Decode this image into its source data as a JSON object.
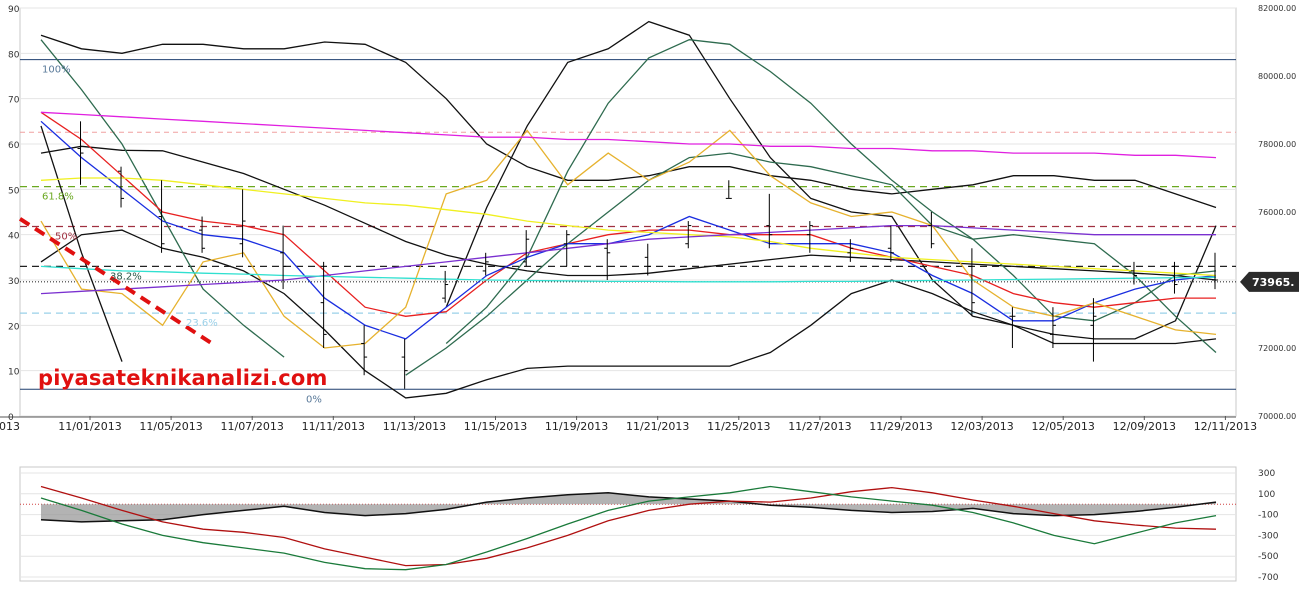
{
  "colors": {
    "black": "#111111",
    "darkgreen": "#2e6b4f",
    "red": "#e82020",
    "blue": "#1a2ee0",
    "gold": "#e6b22e",
    "yellow": "#f0f020",
    "magenta": "#e020e0",
    "purple": "#7a30d0",
    "cyan": "#30e0d0",
    "navy": "#1f3f6f",
    "osc_red": "#b01010",
    "osc_green": "#1a7a3a",
    "osc_hist": "#999999",
    "fib_green": "#6aa820",
    "fib_maroon": "#a03040",
    "fib_lightblue": "#9ad0e8",
    "fib_gray": "#5a7a9a",
    "pink_dash": "#f0a0a0",
    "trend": "#e01010",
    "watermark": "#e01010"
  },
  "watermark": "piyasateknikanalizi.com",
  "last_price": "73965.",
  "chart_data": [
    {
      "type": "line",
      "x": [
        "10/30/2013",
        "11/01/2013",
        "11/04/2013",
        "11/05/2013",
        "11/06/2013",
        "11/07/2013",
        "11/08/2013",
        "11/11/2013",
        "11/12/2013",
        "11/13/2013",
        "11/14/2013",
        "11/15/2013",
        "11/18/2013",
        "11/19/2013",
        "11/20/2013",
        "11/21/2013",
        "11/22/2013",
        "11/25/2013",
        "11/26/2013",
        "11/27/2013",
        "11/28/2013",
        "11/29/2013",
        "12/02/2013",
        "12/03/2013",
        "12/04/2013",
        "12/05/2013",
        "12/06/2013",
        "12/09/2013",
        "12/10/2013",
        "12/11/2013"
      ],
      "x_tick_labels": [
        "2013",
        "11/01/2013",
        "11/05/2013",
        "11/07/2013",
        "11/11/2013",
        "11/13/2013",
        "11/15/2013",
        "11/19/2013",
        "11/21/2013",
        "11/25/2013",
        "11/27/2013",
        "11/29/2013",
        "12/03/2013",
        "12/05/2013",
        "12/09/2013",
        "12/11/2013"
      ],
      "y_left_ticks": [
        "0",
        "10",
        "20",
        "30",
        "40",
        "50",
        "60",
        "70",
        "80",
        "90"
      ],
      "y_left_range": [
        0,
        90
      ],
      "y_right_ticks": [
        "70000.00",
        "72000.00",
        "74000.00",
        "76000.00",
        "78000.00",
        "80000.00",
        "82000.00"
      ],
      "y_right_range": [
        70000,
        82000
      ],
      "grid": true,
      "fib_levels": [
        {
          "label": "100%",
          "value": 78.6
        },
        {
          "label": "61.8%",
          "value": 50.6
        },
        {
          "label": "50%",
          "value": 41.8
        },
        {
          "label": "38.2%",
          "value": 33.0
        },
        {
          "label": "23.6%",
          "value": 22.7
        },
        {
          "label": "0%",
          "value": 5.9
        }
      ],
      "candles": [
        {
          "o": 74.4,
          "h": 64,
          "l": 54,
          "c": 60
        },
        {
          "o": 59,
          "h": 65,
          "l": 51,
          "c": 58
        },
        {
          "o": 54,
          "h": 55,
          "l": 46,
          "c": 48
        },
        {
          "o": 44,
          "h": 52,
          "l": 36,
          "c": 38
        },
        {
          "o": 41,
          "h": 44,
          "l": 36,
          "c": 37
        },
        {
          "o": 38,
          "h": 50,
          "l": 35,
          "c": 43
        },
        {
          "o": 36,
          "h": 42,
          "l": 28,
          "c": 33
        },
        {
          "o": 25,
          "h": 34,
          "l": 15,
          "c": 18
        },
        {
          "o": 16,
          "h": 20,
          "l": 9,
          "c": 13
        },
        {
          "o": 13,
          "h": 17,
          "l": 6,
          "c": 10
        },
        {
          "o": 26,
          "h": 32,
          "l": 25,
          "c": 29
        },
        {
          "o": 32,
          "h": 36,
          "l": 31,
          "c": 34
        },
        {
          "o": 34,
          "h": 41,
          "l": 33,
          "c": 39
        },
        {
          "o": 38,
          "h": 41,
          "l": 33,
          "c": 40
        },
        {
          "o": 37,
          "h": 39,
          "l": 30,
          "c": 36
        },
        {
          "o": 35,
          "h": 38,
          "l": 31,
          "c": 33
        },
        {
          "o": 38,
          "h": 43,
          "l": 37,
          "c": 42
        },
        {
          "o": 48,
          "h": 52,
          "l": 48,
          "c": 48
        },
        {
          "o": 42,
          "h": 49,
          "l": 37,
          "c": 40
        },
        {
          "o": 40,
          "h": 43,
          "l": 36,
          "c": 42
        },
        {
          "o": 36,
          "h": 39,
          "l": 34,
          "c": 37
        },
        {
          "o": 37,
          "h": 42,
          "l": 34,
          "c": 36
        },
        {
          "o": 42,
          "h": 45,
          "l": 37,
          "c": 38
        },
        {
          "o": 33,
          "h": 37,
          "l": 22,
          "c": 25
        },
        {
          "o": 22,
          "h": 24,
          "l": 15,
          "c": 22
        },
        {
          "o": 18,
          "h": 24,
          "l": 15,
          "c": 20
        },
        {
          "o": 20,
          "h": 26,
          "l": 12,
          "c": 22
        },
        {
          "o": 32,
          "h": 34,
          "l": 29,
          "c": 31
        },
        {
          "o": 33,
          "h": 34,
          "l": 27,
          "c": 29
        },
        {
          "o": 30,
          "h": 36,
          "l": 28,
          "c": 30
        }
      ],
      "series": [
        {
          "color": "black",
          "values": [
            58,
            59.5,
            58.6,
            58.5,
            56,
            53.5,
            50,
            46.5,
            42.5,
            38.5,
            35.5,
            33.5,
            32,
            31,
            31,
            31.5,
            32.5,
            33.5,
            34.5,
            35.5,
            35,
            34.5,
            34,
            33.5,
            33,
            32.5,
            32,
            31.5,
            31,
            30
          ]
        },
        {
          "color": "black",
          "values": [
            84,
            81,
            80,
            82,
            82,
            81,
            81,
            82.5,
            82,
            78,
            70,
            60,
            55,
            52,
            52,
            53,
            55,
            55,
            53,
            52,
            50,
            49,
            50,
            51,
            53,
            53,
            52,
            52,
            49,
            46
          ]
        },
        {
          "color": "black",
          "values": [
            34,
            40,
            41,
            37,
            35,
            32,
            27,
            19,
            10,
            4,
            5,
            8,
            10.5,
            11,
            11,
            11,
            11,
            11,
            14,
            20,
            27,
            30,
            27,
            23,
            20,
            16,
            16,
            16,
            16,
            17
          ]
        },
        {
          "color": "black",
          "values": [
            64,
            36,
            12,
            null,
            null,
            null,
            null,
            null,
            null,
            null,
            24,
            46,
            64,
            78,
            81,
            87,
            84,
            70,
            57,
            48,
            45,
            44,
            30,
            22,
            20,
            18,
            17,
            17,
            21,
            42
          ]
        },
        {
          "color": "darkgreen",
          "values": [
            83,
            72,
            60,
            44,
            28,
            20,
            13,
            null,
            null,
            9,
            15,
            22,
            30,
            38,
            45,
            52,
            57,
            58,
            56,
            55,
            53,
            51,
            42,
            39,
            40,
            39,
            38,
            31,
            22,
            14
          ]
        },
        {
          "color": "darkgreen",
          "values": [
            null,
            null,
            null,
            null,
            null,
            null,
            null,
            null,
            null,
            null,
            16,
            24,
            35,
            54,
            69,
            79,
            83,
            82,
            76,
            69,
            60,
            52,
            45,
            39,
            31,
            22,
            21,
            25,
            31,
            32
          ]
        },
        {
          "color": "red",
          "values": [
            67,
            61,
            53,
            45,
            43,
            42,
            40,
            32,
            24,
            22,
            23,
            30,
            36,
            38,
            40,
            41,
            41,
            40,
            40,
            40,
            37,
            35,
            33,
            31,
            27,
            25,
            24,
            25,
            26,
            26
          ]
        },
        {
          "color": "blue",
          "values": [
            65,
            57,
            50,
            43,
            40,
            39,
            36,
            26,
            20,
            17,
            24,
            31,
            35,
            38,
            38,
            40,
            44,
            41,
            38,
            38,
            38,
            36,
            31,
            27,
            21,
            21,
            25,
            28,
            30,
            31
          ]
        },
        {
          "color": "gold",
          "values": [
            43,
            28,
            27,
            20,
            34,
            36,
            22,
            15,
            16,
            24,
            49,
            52,
            63,
            51,
            58,
            52,
            56,
            63,
            53,
            47,
            44,
            45,
            42,
            30,
            24,
            22,
            25,
            22,
            19,
            18
          ]
        },
        {
          "color": "yellow",
          "values": [
            52,
            52.5,
            52.5,
            52,
            51,
            50,
            49,
            48,
            47,
            46.5,
            45.5,
            44.5,
            43,
            42,
            41,
            40.5,
            40,
            39.5,
            38.5,
            37,
            36,
            35,
            34.5,
            34,
            33.5,
            33,
            32.5,
            32,
            31.5,
            31
          ]
        },
        {
          "color": "magenta",
          "values": [
            67,
            66.5,
            66,
            65.5,
            65,
            64.5,
            64,
            63.5,
            63,
            62.5,
            62,
            61.5,
            61.5,
            61,
            61,
            60.5,
            60,
            60,
            59.5,
            59.5,
            59,
            59,
            58.5,
            58.5,
            58,
            58,
            58,
            57.5,
            57.5,
            57
          ]
        },
        {
          "color": "purple",
          "values": [
            27,
            27.5,
            28,
            28.5,
            29,
            29.5,
            30,
            31,
            32,
            33,
            34,
            35,
            36,
            37,
            38,
            39,
            39.5,
            40,
            40.5,
            41,
            41.5,
            42,
            42,
            41.5,
            41,
            40.5,
            40,
            40,
            40,
            40
          ]
        },
        {
          "color": "cyan",
          "values": [
            33,
            32.5,
            32,
            31.8,
            31.5,
            31.3,
            31,
            30.8,
            30.6,
            30.4,
            30.2,
            30,
            29.9,
            29.8,
            29.7,
            29.7,
            29.6,
            29.6,
            29.6,
            29.7,
            29.7,
            29.8,
            29.9,
            30,
            30.1,
            30.2,
            30.3,
            30.4,
            30.5,
            30.6
          ]
        }
      ]
    },
    {
      "type": "area",
      "x": [
        "10/30/2013",
        "11/01/2013",
        "11/04/2013",
        "11/05/2013",
        "11/06/2013",
        "11/07/2013",
        "11/08/2013",
        "11/11/2013",
        "11/12/2013",
        "11/13/2013",
        "11/14/2013",
        "11/15/2013",
        "11/18/2013",
        "11/19/2013",
        "11/20/2013",
        "11/21/2013",
        "11/22/2013",
        "11/25/2013",
        "11/26/2013",
        "11/27/2013",
        "11/28/2013",
        "11/29/2013",
        "12/02/2013",
        "12/03/2013",
        "12/04/2013",
        "12/05/2013",
        "12/06/2013",
        "12/09/2013",
        "12/10/2013",
        "12/11/2013"
      ],
      "y_ticks": [
        "300",
        "100",
        "-100",
        "-300",
        "-500",
        "-700"
      ],
      "ylim": [
        -700,
        300
      ],
      "grid": true,
      "series": [
        {
          "color": "osc_hist",
          "values": [
            -150,
            -170,
            -160,
            -150,
            -100,
            -60,
            -20,
            -80,
            -110,
            -90,
            -50,
            20,
            60,
            90,
            110,
            70,
            50,
            30,
            -10,
            -30,
            -60,
            -80,
            -70,
            -40,
            -90,
            -110,
            -100,
            -70,
            -30,
            20
          ]
        },
        {
          "color": "osc_red",
          "values": [
            170,
            60,
            -60,
            -170,
            -240,
            -270,
            -320,
            -430,
            -510,
            -590,
            -580,
            -520,
            -420,
            -300,
            -160,
            -60,
            0,
            30,
            20,
            60,
            120,
            160,
            110,
            40,
            -20,
            -90,
            -160,
            -200,
            -230,
            -240
          ]
        },
        {
          "color": "osc_green",
          "values": [
            60,
            -60,
            -190,
            -300,
            -370,
            -420,
            -470,
            -560,
            -620,
            -630,
            -580,
            -460,
            -330,
            -190,
            -60,
            30,
            70,
            110,
            170,
            120,
            70,
            30,
            -10,
            -80,
            -180,
            -300,
            -380,
            -280,
            -180,
            -110
          ]
        }
      ]
    }
  ]
}
